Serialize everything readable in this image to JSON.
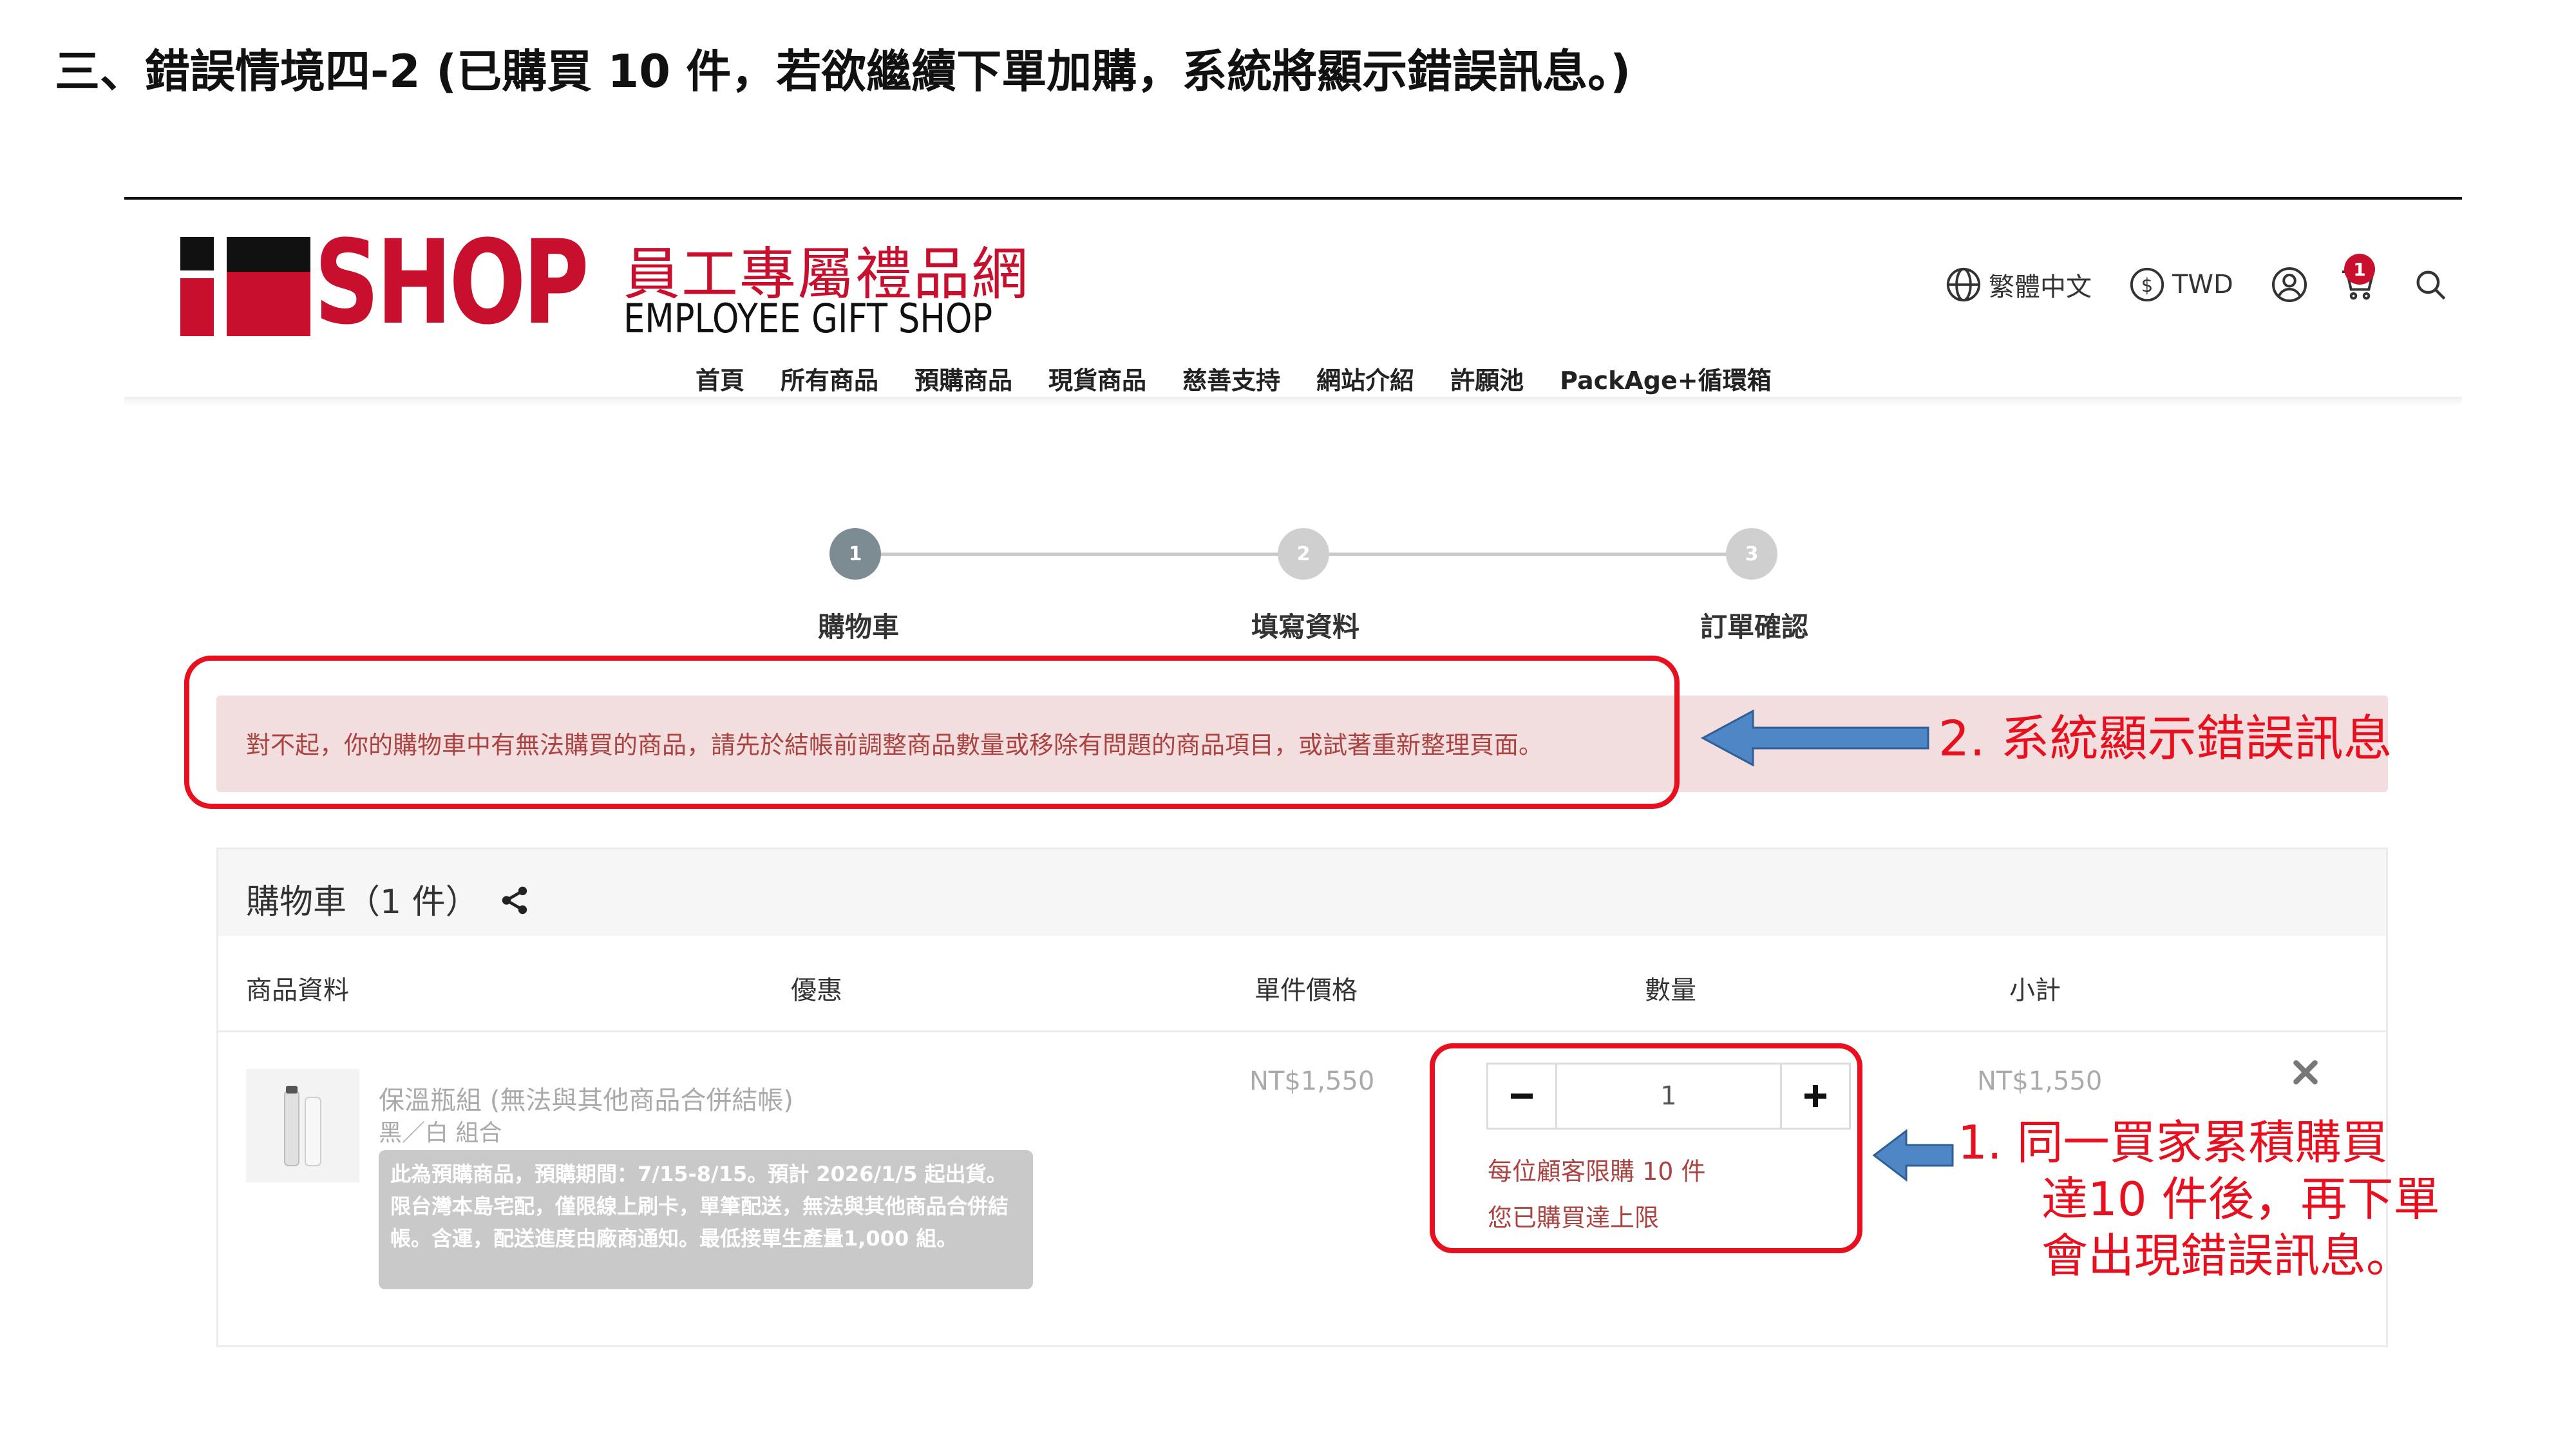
{
  "doc": {
    "heading": "三、錯誤情境四-2 (已購買 10 件，若欲繼續下單加購，系統將顯示錯誤訊息。)"
  },
  "header": {
    "logo": {
      "brand": "SHOP",
      "cn_name": "員工專屬禮品網",
      "en_name": "EMPLOYEE GIFT SHOP"
    },
    "language": "繁體中文",
    "currency": "TWD",
    "cart_count": "1",
    "icons": [
      "globe-icon",
      "dollar-icon",
      "user-icon",
      "cart-icon",
      "search-icon"
    ]
  },
  "nav": {
    "items": [
      "首頁",
      "所有商品",
      "預購商品",
      "現貨商品",
      "慈善支持",
      "網站介紹",
      "許願池",
      "PackAge+循環箱"
    ]
  },
  "steps": [
    {
      "number": "1",
      "label": "購物車"
    },
    {
      "number": "2",
      "label": "填寫資料"
    },
    {
      "number": "3",
      "label": "訂單確認"
    }
  ],
  "error": {
    "message": "對不起，你的購物車中有無法購買的商品，請先於結帳前調整商品數量或移除有問題的商品項目，或試著重新整理頁面。"
  },
  "annotations": {
    "note2": "2.  系統顯示錯誤訊息",
    "note1_line1": "1.  同一買家累積購買",
    "note1_line2": "達10 件後，再下單",
    "note1_line3": "會出現錯誤訊息。"
  },
  "cart": {
    "title": "購物車（1 件）",
    "columns": {
      "product": "商品資料",
      "discount": "優惠",
      "unit_price": "單件價格",
      "quantity": "數量",
      "subtotal": "小計"
    },
    "item": {
      "name": "保溫瓶組 (無法與其他商品合併結帳)",
      "variant": "黑／白 組合",
      "note": "此為預購商品，預購期間：7/15-8/15。預計 2026/1/5 起出貨。限台灣本島宅配，僅限線上刷卡，單筆配送，無法與其他商品合併結帳。含運，配送進度由廠商通知。最低接單生產量1,000 組。",
      "unit_price": "NT$1,550",
      "quantity": "1",
      "limit_msg": "每位顧客限購 10 件",
      "reached_msg": "您已購買達上限",
      "subtotal": "NT$1,550"
    }
  },
  "colors": {
    "brand_red": "#c8102e",
    "annotation_red": "#e8101f",
    "error_bg": "#f2dede",
    "error_text": "#a94442",
    "arrow_blue": "#4f86c6"
  }
}
